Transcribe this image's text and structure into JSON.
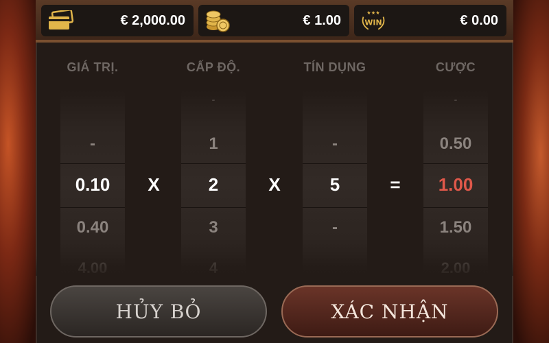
{
  "balance": {
    "icon": "wallet-icon",
    "value": "€ 2,000.00"
  },
  "bet": {
    "icon": "coins-icon",
    "value": "€ 1.00"
  },
  "win": {
    "icon": "win-trophy-icon",
    "icon_text": "WIN",
    "value": "€ 0.00"
  },
  "columns": [
    {
      "header": "GIÁ TRỊ.",
      "above2": "",
      "above": "-",
      "selected": "0.10",
      "below": "0.40",
      "below2": "4.00"
    },
    {
      "header": "CẤP ĐỘ.",
      "above2": "-",
      "above": "1",
      "selected": "2",
      "below": "3",
      "below2": "4"
    },
    {
      "header": "TÍN DỤNG",
      "above2": "",
      "above": "-",
      "selected": "5",
      "below": "-",
      "below2": ""
    },
    {
      "header": "CƯỢC",
      "above2": "-",
      "above": "0.50",
      "selected": "1.00",
      "below": "1.50",
      "below2": "2.00"
    }
  ],
  "operators": [
    "X",
    "X",
    "="
  ],
  "buttons": {
    "cancel": "HỦY BỎ",
    "confirm": "XÁC NHẬN"
  },
  "colors": {
    "selected_bet": "#e0584a",
    "panel": "#231b17",
    "accent_gold": "#e1b54a"
  }
}
